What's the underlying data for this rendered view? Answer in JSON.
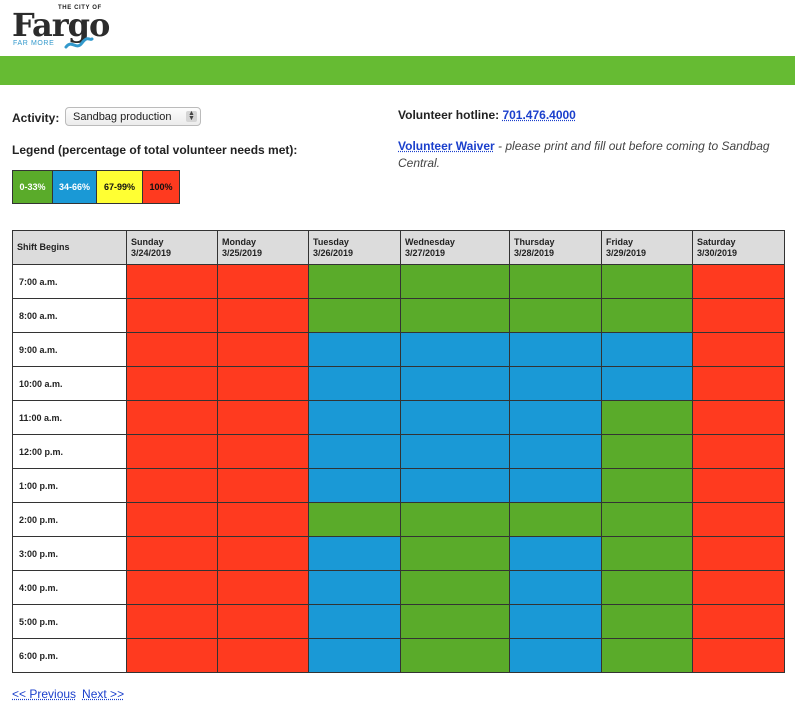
{
  "logo": {
    "city": "THE CITY OF",
    "word": "Fargo",
    "tagline": "FAR MORE"
  },
  "activity": {
    "label": "Activity:",
    "selected": "Sandbag production"
  },
  "legend": {
    "title": "Legend (percentage of total volunteer needs met):",
    "items": [
      {
        "label": "0-33%",
        "color": "#5aab2a",
        "text_color": "#ffffff"
      },
      {
        "label": "34-66%",
        "color": "#1a99d6",
        "text_color": "#ffffff"
      },
      {
        "label": "67-99%",
        "color": "#ffff33",
        "text_color": "#111111"
      },
      {
        "label": "100%",
        "color": "#ff3a1f",
        "text_color": "#111111"
      }
    ]
  },
  "hotline": {
    "label": "Volunteer hotline:",
    "number": "701.476.4000"
  },
  "waiver": {
    "link": "Volunteer Waiver",
    "note": " - please print and fill out before coming to Sandbag Central."
  },
  "schedule": {
    "corner_header": "Shift Begins",
    "days": [
      {
        "name": "Sunday",
        "date": "3/24/2019"
      },
      {
        "name": "Monday",
        "date": "3/25/2019"
      },
      {
        "name": "Tuesday",
        "date": "3/26/2019"
      },
      {
        "name": "Wednesday",
        "date": "3/27/2019"
      },
      {
        "name": "Thursday",
        "date": "3/28/2019"
      },
      {
        "name": "Friday",
        "date": "3/29/2019"
      },
      {
        "name": "Saturday",
        "date": "3/30/2019"
      }
    ],
    "level_colors": {
      "0-33%": "#5aab2a",
      "34-66%": "#1a99d6",
      "67-99%": "#ffff33",
      "100%": "#ff3a1f"
    },
    "rows": [
      {
        "time": "7:00 a.m.",
        "levels": [
          "100%",
          "100%",
          "0-33%",
          "0-33%",
          "0-33%",
          "0-33%",
          "100%"
        ]
      },
      {
        "time": "8:00 a.m.",
        "levels": [
          "100%",
          "100%",
          "0-33%",
          "0-33%",
          "0-33%",
          "0-33%",
          "100%"
        ]
      },
      {
        "time": "9:00 a.m.",
        "levels": [
          "100%",
          "100%",
          "34-66%",
          "34-66%",
          "34-66%",
          "34-66%",
          "100%"
        ]
      },
      {
        "time": "10:00 a.m.",
        "levels": [
          "100%",
          "100%",
          "34-66%",
          "34-66%",
          "34-66%",
          "34-66%",
          "100%"
        ]
      },
      {
        "time": "11:00 a.m.",
        "levels": [
          "100%",
          "100%",
          "34-66%",
          "34-66%",
          "34-66%",
          "0-33%",
          "100%"
        ]
      },
      {
        "time": "12:00 p.m.",
        "levels": [
          "100%",
          "100%",
          "34-66%",
          "34-66%",
          "34-66%",
          "0-33%",
          "100%"
        ]
      },
      {
        "time": "1:00 p.m.",
        "levels": [
          "100%",
          "100%",
          "34-66%",
          "34-66%",
          "34-66%",
          "0-33%",
          "100%"
        ]
      },
      {
        "time": "2:00 p.m.",
        "levels": [
          "100%",
          "100%",
          "0-33%",
          "0-33%",
          "0-33%",
          "0-33%",
          "100%"
        ]
      },
      {
        "time": "3:00 p.m.",
        "levels": [
          "100%",
          "100%",
          "34-66%",
          "0-33%",
          "34-66%",
          "0-33%",
          "100%"
        ]
      },
      {
        "time": "4:00 p.m.",
        "levels": [
          "100%",
          "100%",
          "34-66%",
          "0-33%",
          "34-66%",
          "0-33%",
          "100%"
        ]
      },
      {
        "time": "5:00 p.m.",
        "levels": [
          "100%",
          "100%",
          "34-66%",
          "0-33%",
          "34-66%",
          "0-33%",
          "100%"
        ]
      },
      {
        "time": "6:00 p.m.",
        "levels": [
          "100%",
          "100%",
          "34-66%",
          "0-33%",
          "34-66%",
          "0-33%",
          "100%"
        ]
      }
    ]
  },
  "pager": {
    "previous": "<< Previous",
    "next": "Next >>"
  }
}
